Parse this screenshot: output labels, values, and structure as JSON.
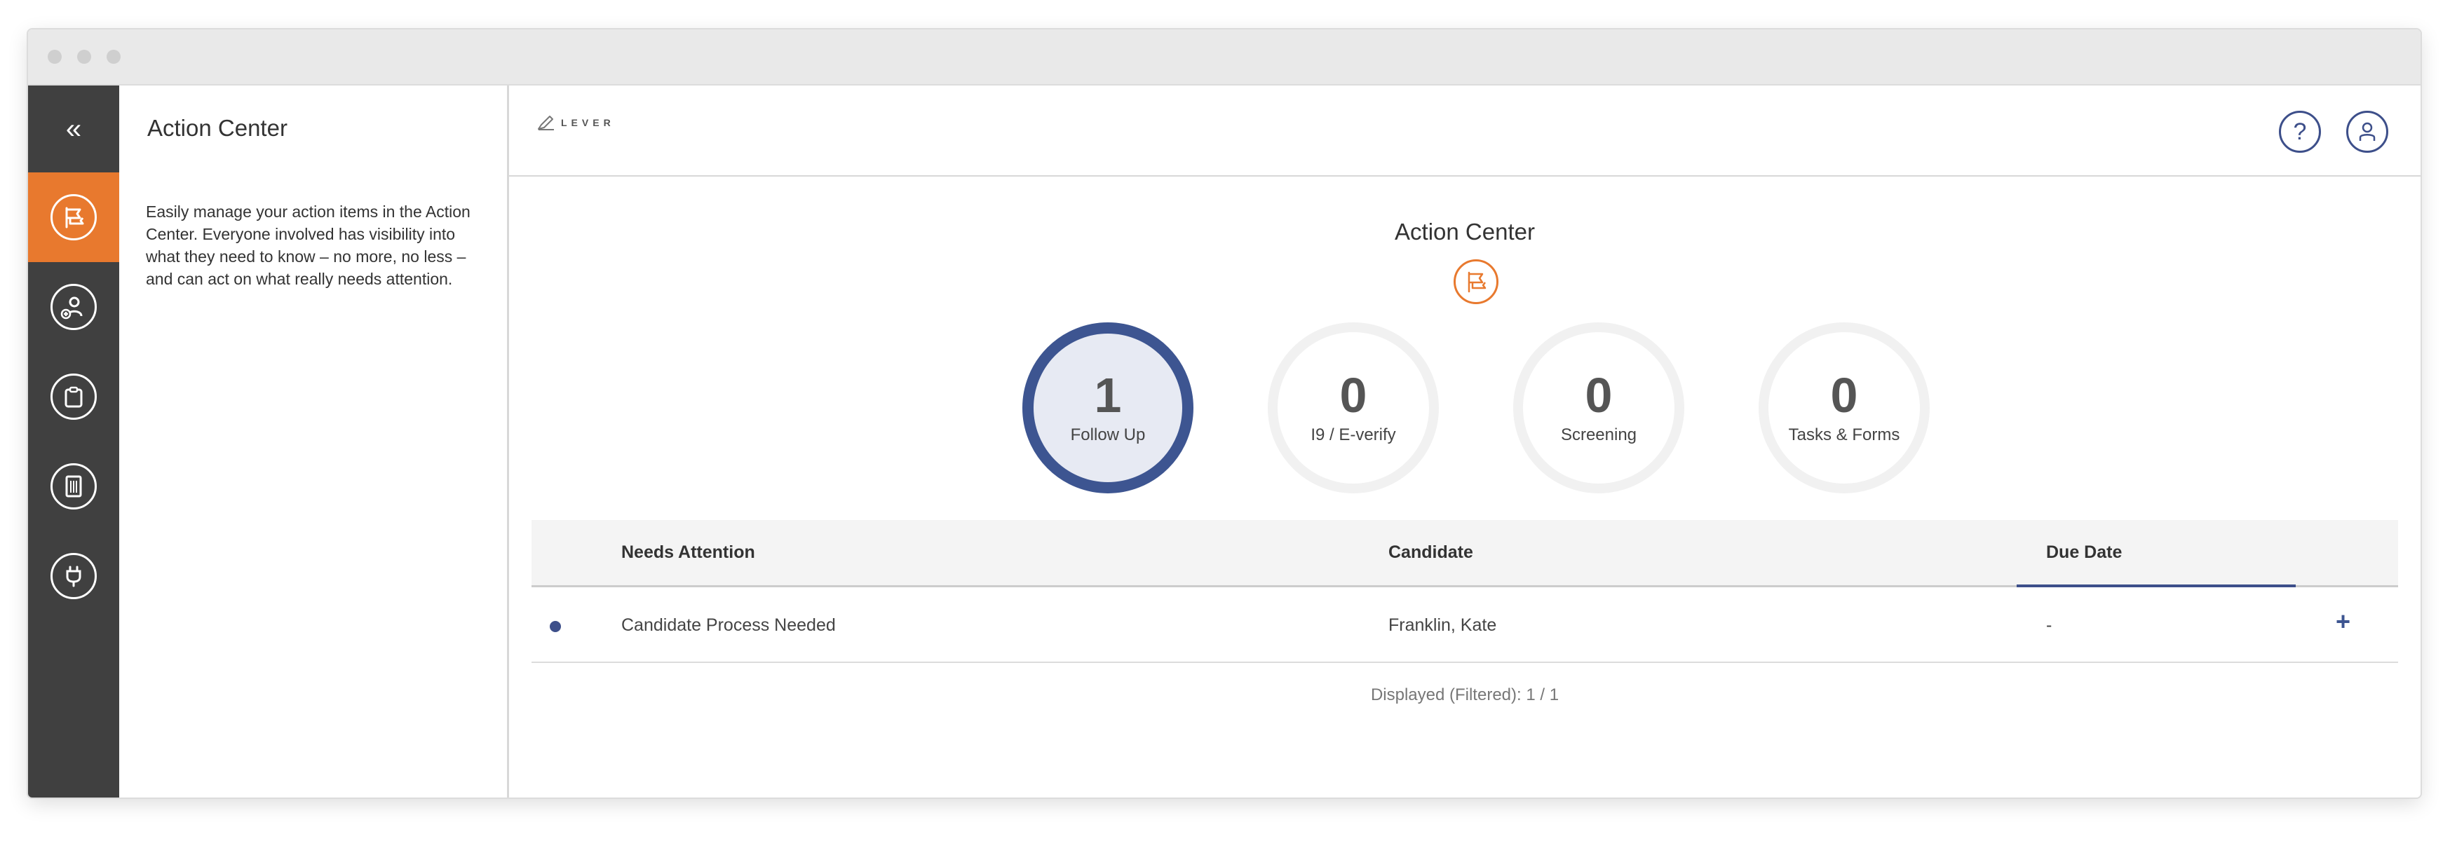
{
  "sidebar": {
    "collapse_glyph": "«",
    "items": [
      {
        "icon": "flag-icon",
        "active": true
      },
      {
        "icon": "add-user-icon",
        "active": false
      },
      {
        "icon": "clipboard-icon",
        "active": false
      },
      {
        "icon": "building-icon",
        "active": false
      },
      {
        "icon": "plug-icon",
        "active": false
      }
    ],
    "accent_color": "#e8792e",
    "background_color": "#404040"
  },
  "info_panel": {
    "title": "Action Center",
    "description": "Easily manage your action items in the Action Center. Everyone involved has visibility into what they need to know – no more, no less – and can act on what really needs attention."
  },
  "header": {
    "logo_text": "LEVER",
    "help_glyph": "?"
  },
  "main": {
    "title": "Action Center",
    "stats": [
      {
        "count": "1",
        "label": "Follow Up",
        "active": true
      },
      {
        "count": "0",
        "label": "I9 / E-verify",
        "active": false
      },
      {
        "count": "0",
        "label": "Screening",
        "active": false
      },
      {
        "count": "0",
        "label": "Tasks & Forms",
        "active": false
      }
    ],
    "table": {
      "columns": [
        "Needs Attention",
        "Candidate",
        "Due Date"
      ],
      "rows": [
        {
          "needs_attention": "Candidate Process Needed",
          "candidate": "Franklin, Kate",
          "due_date": "-",
          "action": "+"
        }
      ]
    },
    "count_text": "Displayed (Filtered): 1 / 1"
  },
  "colors": {
    "primary": "#3d4f8a",
    "accent": "#e8792e"
  }
}
